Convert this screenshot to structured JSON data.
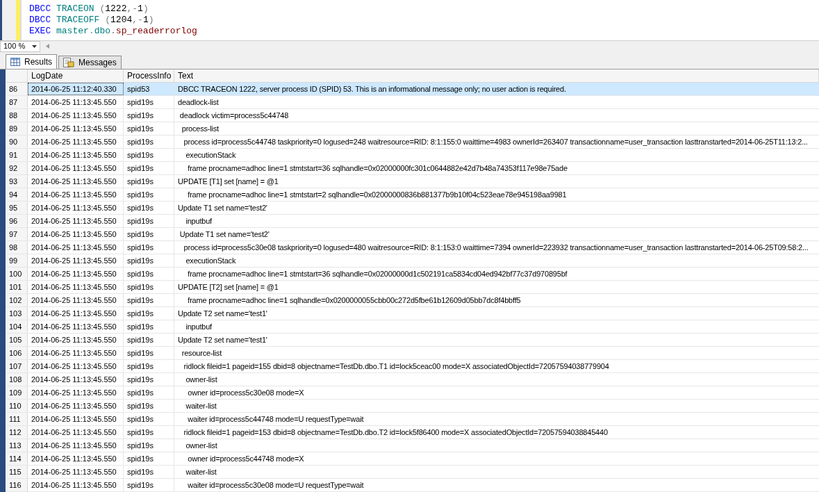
{
  "editor": {
    "lines": [
      [
        {
          "kind": "keyword",
          "text": "DBCC"
        },
        {
          "kind": "function",
          "text": "TRACEON"
        },
        {
          "kind": "punct",
          "text": "("
        },
        {
          "kind": "number",
          "text": "1222"
        },
        {
          "kind": "punct",
          "text": ",-"
        },
        {
          "kind": "number",
          "text": "1"
        },
        {
          "kind": "punct",
          "text": ")"
        }
      ],
      [
        {
          "kind": "keyword",
          "text": "DBCC"
        },
        {
          "kind": "function",
          "text": "TRACEOFF"
        },
        {
          "kind": "punct",
          "text": "("
        },
        {
          "kind": "number",
          "text": "1204"
        },
        {
          "kind": "punct",
          "text": ",-"
        },
        {
          "kind": "number",
          "text": "1"
        },
        {
          "kind": "punct",
          "text": ")"
        }
      ],
      [
        {
          "kind": "keyword",
          "text": "EXEC"
        },
        {
          "kind": "function",
          "text": "master"
        },
        {
          "kind": "punct",
          "text": "."
        },
        {
          "kind": "function",
          "text": "dbo"
        },
        {
          "kind": "punct",
          "text": "."
        },
        {
          "kind": "proc",
          "text": "sp_readerrorlog"
        }
      ]
    ]
  },
  "zoom": {
    "value": "100 %"
  },
  "tabs": [
    {
      "label": "Results",
      "selected": true
    },
    {
      "label": "Messages",
      "selected": false
    }
  ],
  "grid": {
    "columns": [
      "LogDate",
      "ProcessInfo",
      "Text"
    ],
    "rows": [
      {
        "n": "86",
        "date": "2014-06-25 11:12:40.330",
        "proc": "spid53",
        "text": "DBCC TRACEON 1222, server process ID (SPID) 53. This is an informational message only; no user action is required.",
        "selected": true
      },
      {
        "n": "87",
        "date": "2014-06-25 11:13:45.550",
        "proc": "spid19s",
        "text": "deadlock-list",
        "selected": false
      },
      {
        "n": "88",
        "date": "2014-06-25 11:13:45.550",
        "proc": "spid19s",
        "text": " deadlock victim=process5c44748",
        "selected": false
      },
      {
        "n": "89",
        "date": "2014-06-25 11:13:45.550",
        "proc": "spid19s",
        "text": "  process-list",
        "selected": false
      },
      {
        "n": "90",
        "date": "2014-06-25 11:13:45.550",
        "proc": "spid19s",
        "text": "   process id=process5c44748 taskpriority=0 logused=248 waitresource=RID: 8:1:155:0 waittime=4983 ownerId=263407 transactionname=user_transaction lasttranstarted=2014-06-25T11:13:2...",
        "selected": false
      },
      {
        "n": "91",
        "date": "2014-06-25 11:13:45.550",
        "proc": "spid19s",
        "text": "    executionStack",
        "selected": false
      },
      {
        "n": "92",
        "date": "2014-06-25 11:13:45.550",
        "proc": "spid19s",
        "text": "     frame procname=adhoc line=1 stmtstart=36 sqlhandle=0x02000000fc301c0644882e42d7b48a74353f117e98e75ade",
        "selected": false
      },
      {
        "n": "93",
        "date": "2014-06-25 11:13:45.550",
        "proc": "spid19s",
        "text": "UPDATE [T1] set [name] = @1",
        "selected": false
      },
      {
        "n": "94",
        "date": "2014-06-25 11:13:45.550",
        "proc": "spid19s",
        "text": "     frame procname=adhoc line=1 stmtstart=2 sqlhandle=0x02000000836b881377b9b10f04c523eae78e945198aa9981",
        "selected": false
      },
      {
        "n": "95",
        "date": "2014-06-25 11:13:45.550",
        "proc": "spid19s",
        "text": "Update T1 set name='test2'",
        "selected": false
      },
      {
        "n": "96",
        "date": "2014-06-25 11:13:45.550",
        "proc": "spid19s",
        "text": "    inputbuf",
        "selected": false
      },
      {
        "n": "97",
        "date": "2014-06-25 11:13:45.550",
        "proc": "spid19s",
        "text": " Update T1 set name='test2'",
        "selected": false
      },
      {
        "n": "98",
        "date": "2014-06-25 11:13:45.550",
        "proc": "spid19s",
        "text": "   process id=process5c30e08 taskpriority=0 logused=480 waitresource=RID: 8:1:153:0 waittime=7394 ownerId=223932 transactionname=user_transaction lasttranstarted=2014-06-25T09:58:2...",
        "selected": false
      },
      {
        "n": "99",
        "date": "2014-06-25 11:13:45.550",
        "proc": "spid19s",
        "text": "    executionStack",
        "selected": false
      },
      {
        "n": "100",
        "date": "2014-06-25 11:13:45.550",
        "proc": "spid19s",
        "text": "     frame procname=adhoc line=1 stmtstart=36 sqlhandle=0x02000000d1c502191ca5834cd04ed942bf77c37d970895bf",
        "selected": false
      },
      {
        "n": "101",
        "date": "2014-06-25 11:13:45.550",
        "proc": "spid19s",
        "text": "UPDATE [T2] set [name] = @1",
        "selected": false
      },
      {
        "n": "102",
        "date": "2014-06-25 11:13:45.550",
        "proc": "spid19s",
        "text": "     frame procname=adhoc line=1 sqlhandle=0x0200000055cbb00c272d5fbe61b12609d05bb7dc8f4bbff5",
        "selected": false
      },
      {
        "n": "103",
        "date": "2014-06-25 11:13:45.550",
        "proc": "spid19s",
        "text": "Update T2 set name='test1'",
        "selected": false
      },
      {
        "n": "104",
        "date": "2014-06-25 11:13:45.550",
        "proc": "spid19s",
        "text": "    inputbuf",
        "selected": false
      },
      {
        "n": "105",
        "date": "2014-06-25 11:13:45.550",
        "proc": "spid19s",
        "text": "Update T2 set name='test1'",
        "selected": false
      },
      {
        "n": "106",
        "date": "2014-06-25 11:13:45.550",
        "proc": "spid19s",
        "text": "  resource-list",
        "selected": false
      },
      {
        "n": "107",
        "date": "2014-06-25 11:13:45.550",
        "proc": "spid19s",
        "text": "   ridlock fileid=1 pageid=155 dbid=8 objectname=TestDb.dbo.T1 id=lock5ceac00 mode=X associatedObjectId=72057594038779904",
        "selected": false
      },
      {
        "n": "108",
        "date": "2014-06-25 11:13:45.550",
        "proc": "spid19s",
        "text": "    owner-list",
        "selected": false
      },
      {
        "n": "109",
        "date": "2014-06-25 11:13:45.550",
        "proc": "spid19s",
        "text": "     owner id=process5c30e08 mode=X",
        "selected": false
      },
      {
        "n": "110",
        "date": "2014-06-25 11:13:45.550",
        "proc": "spid19s",
        "text": "    waiter-list",
        "selected": false
      },
      {
        "n": "111",
        "date": "2014-06-25 11:13:45.550",
        "proc": "spid19s",
        "text": "     waiter id=process5c44748 mode=U requestType=wait",
        "selected": false
      },
      {
        "n": "112",
        "date": "2014-06-25 11:13:45.550",
        "proc": "spid19s",
        "text": "   ridlock fileid=1 pageid=153 dbid=8 objectname=TestDb.dbo.T2 id=lock5f86400 mode=X associatedObjectId=72057594038845440",
        "selected": false
      },
      {
        "n": "113",
        "date": "2014-06-25 11:13:45.550",
        "proc": "spid19s",
        "text": "    owner-list",
        "selected": false
      },
      {
        "n": "114",
        "date": "2014-06-25 11:13:45.550",
        "proc": "spid19s",
        "text": "     owner id=process5c44748 mode=X",
        "selected": false
      },
      {
        "n": "115",
        "date": "2014-06-25 11:13:45.550",
        "proc": "spid19s",
        "text": "    waiter-list",
        "selected": false
      },
      {
        "n": "116",
        "date": "2014-06-25 11:13:45.550",
        "proc": "spid19s",
        "text": "     waiter id=process5c30e08 mode=U requestType=wait",
        "selected": false
      }
    ]
  }
}
